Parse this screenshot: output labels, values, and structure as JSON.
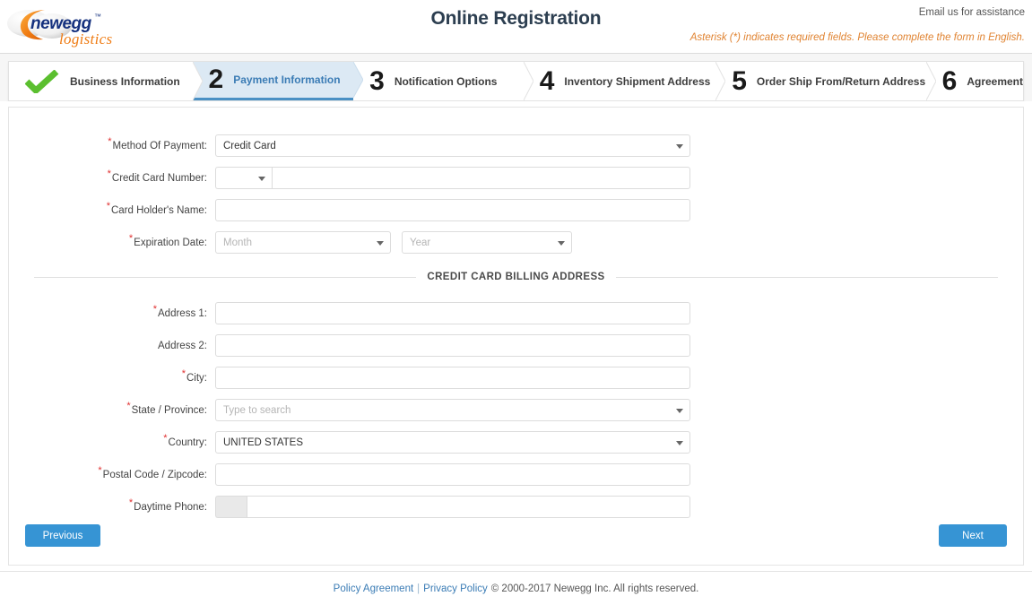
{
  "header": {
    "logo": {
      "brand": "newegg",
      "trademark": "™",
      "sub": "logistics",
      "brand_color": "#15317e",
      "swoosh_color": "#ef7c14",
      "sub_color": "#ef7c14"
    },
    "title": "Online Registration",
    "email_assistance": "Email us for assistance",
    "asterisk_note": "Asterisk (*) indicates required fields. Please complete the form in English.",
    "note_color": "#e08331"
  },
  "stepper": {
    "active_index": 1,
    "active_bg": "#dce9f4",
    "active_accent": "#4a90c4",
    "check_color": "#5bbf2f",
    "steps": [
      {
        "num": "",
        "icon": "check-icon",
        "label": "Business Information",
        "state": "complete"
      },
      {
        "num": "2",
        "icon": "",
        "label": "Payment Information",
        "state": "active"
      },
      {
        "num": "3",
        "icon": "",
        "label": "Notification Options",
        "state": "upcoming"
      },
      {
        "num": "4",
        "icon": "",
        "label": "Inventory Shipment Address",
        "state": "upcoming"
      },
      {
        "num": "5",
        "icon": "",
        "label": "Order Ship From/Return Address",
        "state": "upcoming"
      },
      {
        "num": "6",
        "icon": "",
        "label": "Agreement",
        "state": "upcoming"
      }
    ]
  },
  "form": {
    "method_of_payment": {
      "label": "Method Of Payment:",
      "required": true,
      "value": "Credit Card",
      "caret": "chevron-down-icon"
    },
    "credit_card_number": {
      "label": "Credit Card Number:",
      "required": true,
      "card_type_value": "",
      "number_value": "",
      "caret": "chevron-down-icon"
    },
    "card_holder_name": {
      "label": "Card Holder's Name:",
      "required": true,
      "value": ""
    },
    "expiration_date": {
      "label": "Expiration Date:",
      "required": true,
      "month_placeholder": "Month",
      "month_value": "",
      "year_placeholder": "Year",
      "year_value": ""
    },
    "billing_section_title": "CREDIT CARD BILLING ADDRESS",
    "address1": {
      "label": "Address 1:",
      "required": true,
      "value": ""
    },
    "address2": {
      "label": "Address 2:",
      "required": false,
      "value": ""
    },
    "city": {
      "label": "City:",
      "required": true,
      "value": ""
    },
    "state_province": {
      "label": "State / Province:",
      "required": true,
      "placeholder": "Type to search",
      "value": ""
    },
    "country": {
      "label": "Country:",
      "required": true,
      "value": "UNITED STATES"
    },
    "postal_code": {
      "label": "Postal Code / Zipcode:",
      "required": true,
      "value": ""
    },
    "daytime_phone": {
      "label": "Daytime Phone:",
      "required": true,
      "prefix": "",
      "value": ""
    },
    "required_marker": "*"
  },
  "actions": {
    "previous_label": "Previous",
    "next_label": "Next",
    "button_color": "#3694d4"
  },
  "footer": {
    "policy_agreement": "Policy Agreement",
    "separator": "|",
    "privacy_policy": "Privacy Policy",
    "copyright": "© 2000-2017 Newegg Inc. All rights reserved.",
    "link_color": "#3b7cb5"
  }
}
